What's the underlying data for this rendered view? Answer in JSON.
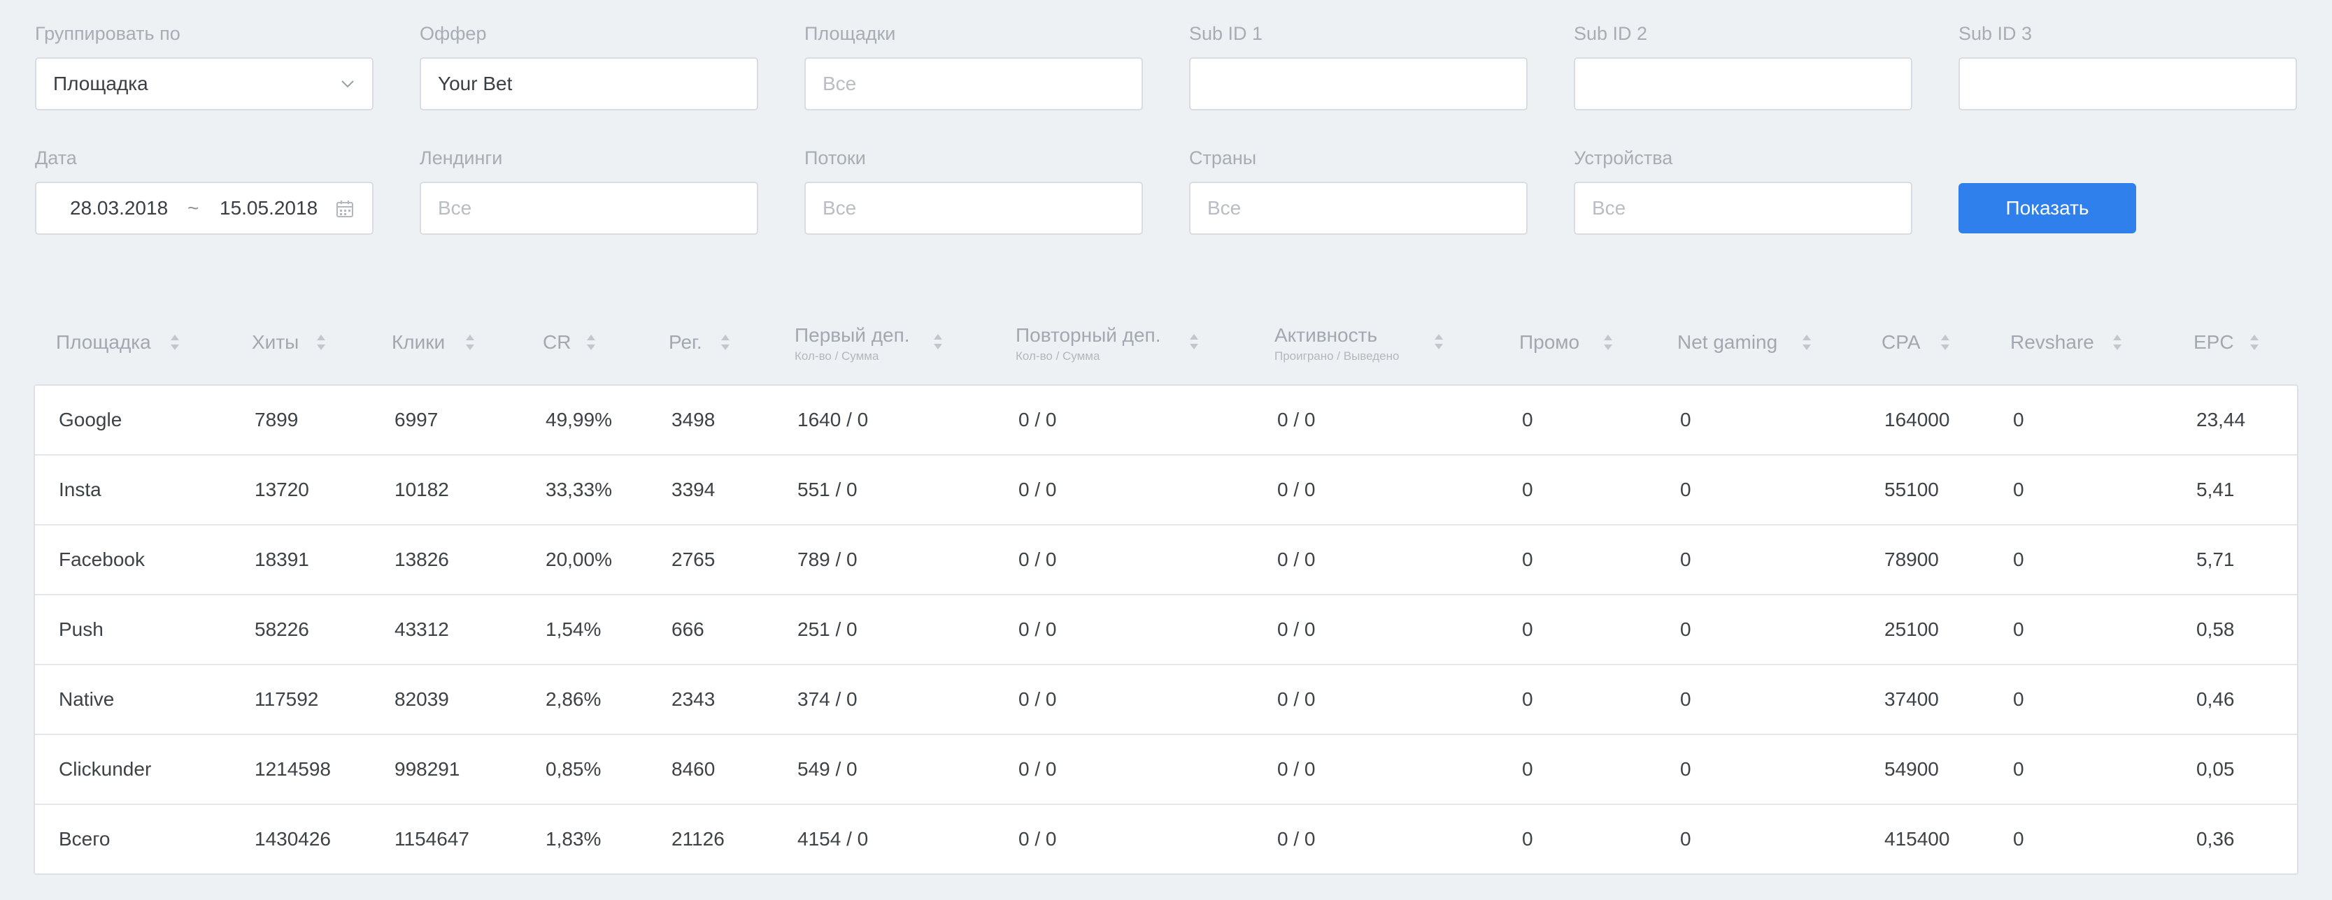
{
  "filters": {
    "group_by": {
      "label": "Группировать по",
      "value": "Площадка"
    },
    "offer": {
      "label": "Оффер",
      "value": "Your Bet"
    },
    "sites": {
      "label": "Площадки",
      "placeholder": "Все"
    },
    "sub_id_1": {
      "label": "Sub ID 1",
      "value": ""
    },
    "sub_id_2": {
      "label": "Sub ID 2",
      "value": ""
    },
    "sub_id_3": {
      "label": "Sub ID 3",
      "value": ""
    },
    "date": {
      "label": "Дата",
      "from": "28.03.2018",
      "separator": "~",
      "to": "15.05.2018"
    },
    "landings": {
      "label": "Лендинги",
      "placeholder": "Все"
    },
    "streams": {
      "label": "Потоки",
      "placeholder": "Все"
    },
    "countries": {
      "label": "Страны",
      "placeholder": "Все"
    },
    "devices": {
      "label": "Устройства",
      "placeholder": "Все"
    },
    "show_button": "Показать"
  },
  "table": {
    "headers": [
      {
        "title": "Площадка",
        "sub": ""
      },
      {
        "title": "Хиты",
        "sub": ""
      },
      {
        "title": "Клики",
        "sub": ""
      },
      {
        "title": "CR",
        "sub": ""
      },
      {
        "title": "Рег.",
        "sub": ""
      },
      {
        "title": "Первый деп.",
        "sub": "Кол-во / Сумма"
      },
      {
        "title": "Повторный деп.",
        "sub": "Кол-во / Сумма"
      },
      {
        "title": "Активность",
        "sub": "Проиграно / Выведено"
      },
      {
        "title": "Промо",
        "sub": ""
      },
      {
        "title": "Net gaming",
        "sub": ""
      },
      {
        "title": "CPA",
        "sub": ""
      },
      {
        "title": "Revshare",
        "sub": ""
      },
      {
        "title": "EPC",
        "sub": ""
      }
    ],
    "rows": [
      [
        "Google",
        "7899",
        "6997",
        "49,99%",
        "3498",
        "1640 / 0",
        "0 / 0",
        "0 / 0",
        "0",
        "0",
        "164000",
        "0",
        "23,44"
      ],
      [
        "Insta",
        "13720",
        "10182",
        "33,33%",
        "3394",
        "551 / 0",
        "0 / 0",
        "0 / 0",
        "0",
        "0",
        "55100",
        "0",
        "5,41"
      ],
      [
        "Facebook",
        "18391",
        "13826",
        "20,00%",
        "2765",
        "789 / 0",
        "0 / 0",
        "0 / 0",
        "0",
        "0",
        "78900",
        "0",
        "5,71"
      ],
      [
        "Push",
        "58226",
        "43312",
        "1,54%",
        "666",
        "251 / 0",
        "0 / 0",
        "0 / 0",
        "0",
        "0",
        "25100",
        "0",
        "0,58"
      ],
      [
        "Native",
        "117592",
        "82039",
        "2,86%",
        "2343",
        "374 / 0",
        "0 / 0",
        "0 / 0",
        "0",
        "0",
        "37400",
        "0",
        "0,46"
      ],
      [
        "Clickunder",
        "1214598",
        "998291",
        "0,85%",
        "8460",
        "549 / 0",
        "0 / 0",
        "0 / 0",
        "0",
        "0",
        "54900",
        "0",
        "0,05"
      ],
      [
        "Всего",
        "1430426",
        "1154647",
        "1,83%",
        "21126",
        "4154 / 0",
        "0 / 0",
        "0 / 0",
        "0",
        "0",
        "415400",
        "0",
        "0,36"
      ]
    ]
  },
  "colors": {
    "accent": "#2f80ed",
    "background": "#eef1f4"
  },
  "icons": {
    "select": "chevron-down-icon",
    "date": "calendar-icon",
    "sort": "sort-icon"
  }
}
